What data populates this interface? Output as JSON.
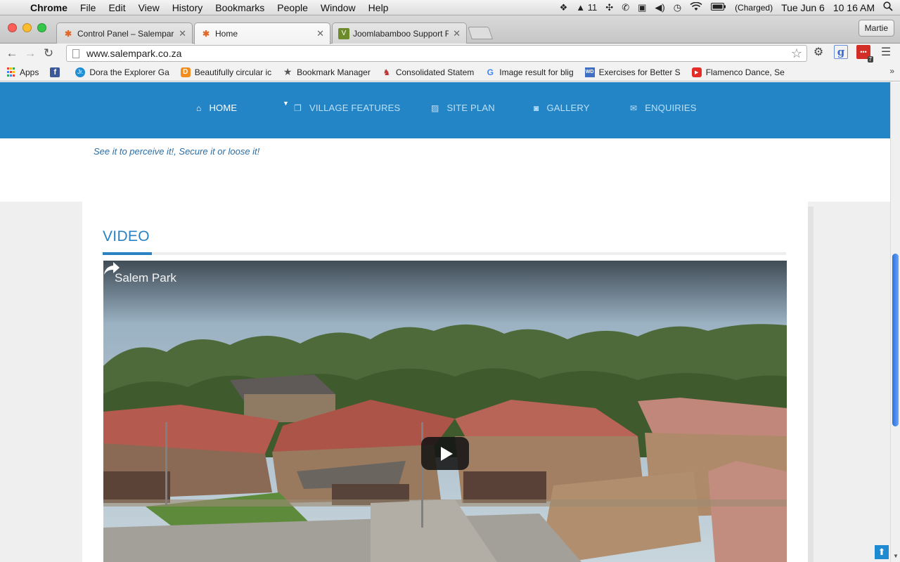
{
  "menubar": {
    "items": [
      "Chrome",
      "File",
      "Edit",
      "View",
      "History",
      "Bookmarks",
      "People",
      "Window",
      "Help"
    ],
    "status": {
      "adobe_count": "11",
      "battery": "(Charged)",
      "date": "Tue Jun 6",
      "time": "10 16 AM"
    }
  },
  "tabs": [
    {
      "title": "Control Panel – Salempark",
      "favicon": "joomla-icon"
    },
    {
      "title": "Home",
      "favicon": "joomla-icon",
      "active": true
    },
    {
      "title": "Joomlabamboo Support Fo",
      "favicon": "bamboo-icon"
    }
  ],
  "profile": {
    "name": "Martie"
  },
  "address_bar": {
    "url": "www.salempark.co.za"
  },
  "bookmarks": [
    {
      "label": "Apps",
      "icon": "apps-grid-icon"
    },
    {
      "label": "",
      "icon": "facebook-icon"
    },
    {
      "label": "Dora the Explorer Ga",
      "icon": "jr-icon"
    },
    {
      "label": "Beautifully circular ic",
      "icon": "d-icon"
    },
    {
      "label": "Bookmark Manager",
      "icon": "star-icon"
    },
    {
      "label": "Consolidated Statem",
      "icon": "consolidated-icon"
    },
    {
      "label": "Image result for blig",
      "icon": "google-icon"
    },
    {
      "label": "Exercises for Better S",
      "icon": "wd-icon"
    },
    {
      "label": "Flamenco Dance, Se",
      "icon": "youtube-icon"
    }
  ],
  "site": {
    "nav": [
      {
        "label": "HOME",
        "icon": "home-icon",
        "active": true
      },
      {
        "label": "VILLAGE FEATURES",
        "icon": "copy-icon",
        "has_dropdown": true
      },
      {
        "label": "SITE PLAN",
        "icon": "picture-icon"
      },
      {
        "label": "GALLERY",
        "icon": "camera-icon"
      },
      {
        "label": "ENQUIRIES",
        "icon": "envelope-icon"
      }
    ],
    "tagline": "See it to perceive it!, Secure it or loose it!",
    "section_title": "VIDEO",
    "video": {
      "title": "Salem Park"
    }
  },
  "colors": {
    "nav_bg": "#2485c6",
    "accent": "#2a82c3",
    "page_bg": "#efefef"
  }
}
